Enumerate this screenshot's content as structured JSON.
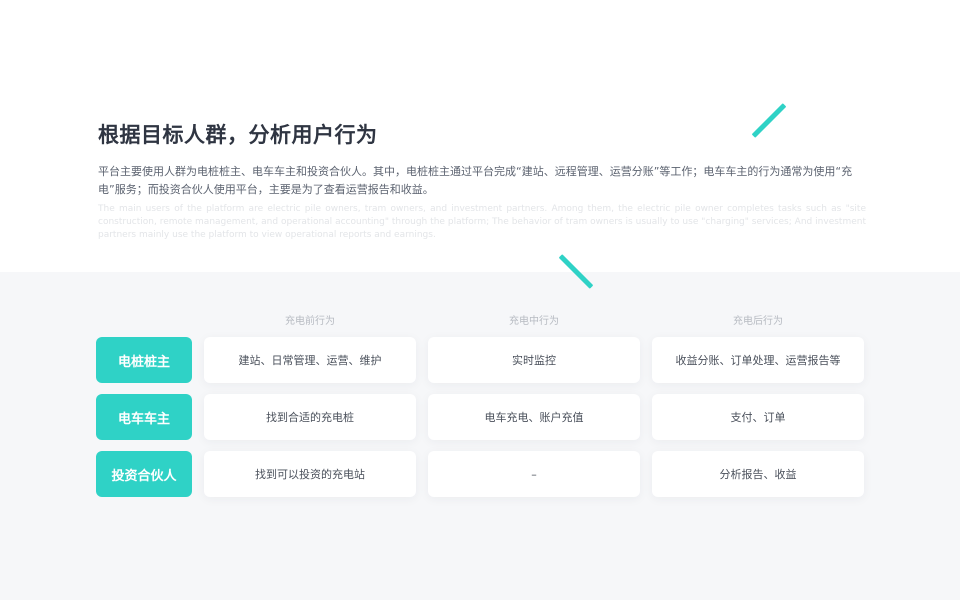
{
  "header": {
    "title": "根据目标人群，分析用户行为",
    "description": "平台主要使用人群为电桩桩主、电车车主和投资合伙人。其中，电桩桩主通过平台完成“建站、远程管理、运营分账”等工作；电车车主的行为通常为使用“充电”服务；而投资合伙人使用平台，主要是为了查看运营报告和收益。",
    "description_en": "The main users of the platform are electric pile owners, tram owners, and investment partners. Among them, the electric pile owner completes tasks such as \"site construction, remote management, and operational accounting\" through the platform; The behavior of tram owners is usually to use \"charging\" services; And investment partners mainly use the platform to view operational reports and earnings."
  },
  "table": {
    "columns": [
      "充电前行为",
      "充电中行为",
      "充电后行为"
    ],
    "rows": [
      {
        "label": "电桩桩主",
        "cells": [
          "建站、日常管理、运营、维护",
          "实时监控",
          "收益分账、订单处理、运营报告等"
        ]
      },
      {
        "label": "电车车主",
        "cells": [
          "找到合适的充电桩",
          "电车充电、账户充值",
          "支付、订单"
        ]
      },
      {
        "label": "投资合伙人",
        "cells": [
          "找到可以投资的充电站",
          "–",
          "分析报告、收益"
        ]
      }
    ]
  },
  "colors": {
    "accent": "#2fd2c6",
    "title": "#2f3542",
    "body_text": "#5c6370",
    "section_bg": "#f6f7f9"
  }
}
